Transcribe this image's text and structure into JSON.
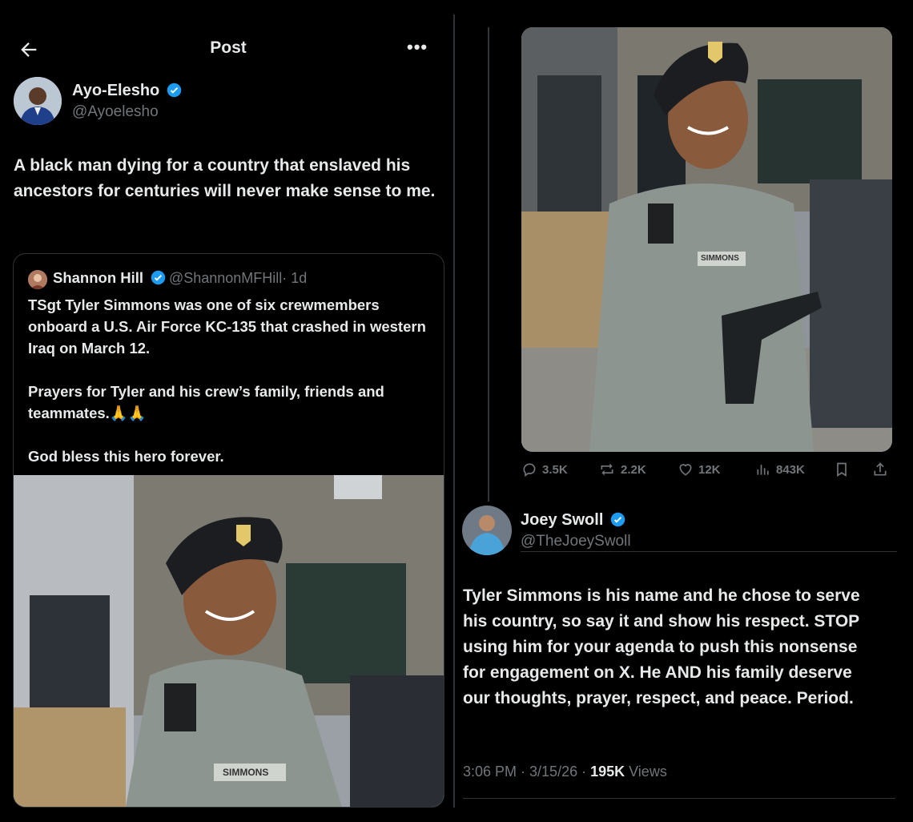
{
  "header": {
    "title": "Post"
  },
  "main_post": {
    "author_name": "Ayo-Elesho",
    "author_handle": "@Ayoelesho",
    "text": "A black man dying for a country that enslaved his ancestors for centuries will never make sense to me."
  },
  "quoted_post": {
    "author_name": "Shannon Hill",
    "author_handle": "@ShannonMFHill",
    "age": "· 1d",
    "text": "TSgt Tyler Simmons was one of six crewmembers onboard a U.S. Air Force KC-135 that crashed in western Iraq on March 12.\n\nPrayers for Tyler and his crew’s family, friends and teammates.🙏🙏\n\nGod bless this hero forever.",
    "photo_name_tape": "SIMMONS"
  },
  "right_post": {
    "photo_name_tape": "SIMMONS",
    "stats": {
      "replies": "3.5K",
      "reposts": "2.2K",
      "likes": "12K",
      "views": "843K"
    }
  },
  "reply_post": {
    "author_name": "Joey Swoll",
    "author_handle": "@TheJoeySwoll",
    "text": "Tyler Simmons is his name and he chose to serve his country, so say it and show his respect. STOP using him for your agenda to push this nonsense for engagement on X. He AND his family deserve our thoughts, prayer, respect, and peace. Period.",
    "time": "3:06 PM · 3/15/26 · ",
    "views_count": "195K",
    "views_label": " Views"
  },
  "colors": {
    "verified": "#1d9bf0",
    "muted": "#71767b",
    "text": "#e7e9ea",
    "border": "#2f3336"
  },
  "icons": [
    "back-arrow-icon",
    "more-icon",
    "verified-icon",
    "reply-icon",
    "repost-icon",
    "like-icon",
    "views-icon",
    "bookmark-icon",
    "share-icon"
  ]
}
